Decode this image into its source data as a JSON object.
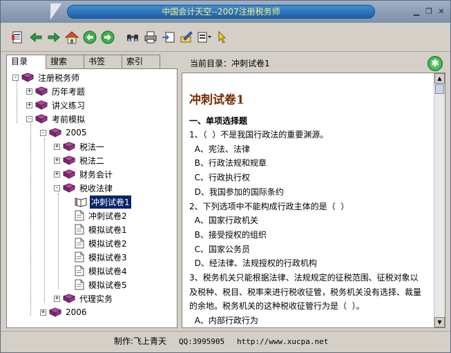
{
  "window": {
    "title": "中国会计天空--2007注册税务师"
  },
  "window_buttons": [
    "▁",
    "❐",
    "✕"
  ],
  "toolbar": {
    "buttons": [
      {
        "icon": "contents-icon"
      },
      {
        "icon": "arrow-left-icon"
      },
      {
        "icon": "arrow-right-icon"
      },
      {
        "icon": "home-icon"
      },
      {
        "icon": "back-circle-icon"
      },
      {
        "icon": "forward-circle-icon"
      },
      {
        "icon": "find-binoculars-icon"
      },
      {
        "icon": "print-icon"
      },
      {
        "icon": "bookmark-add-icon"
      },
      {
        "icon": "edit-notes-icon"
      },
      {
        "icon": "options-menu-icon"
      },
      {
        "icon": "pointer-hand-icon"
      }
    ]
  },
  "tabs": [
    "目录",
    "搜索",
    "书签",
    "索引"
  ],
  "tree": {
    "root": "注册税务师",
    "items": [
      {
        "label": "历年考题",
        "toggle": "+"
      },
      {
        "label": "讲义练习",
        "toggle": "+"
      },
      {
        "label": "考前模拟",
        "toggle": "-"
      },
      {
        "label": "2005",
        "toggle": "-"
      },
      {
        "label": "税法一",
        "toggle": "+"
      },
      {
        "label": "税法二",
        "toggle": "+"
      },
      {
        "label": "财务会计",
        "toggle": "+"
      },
      {
        "label": "税收法律",
        "toggle": "-"
      },
      {
        "label": "冲刺试卷1"
      },
      {
        "label": "冲刺试卷2"
      },
      {
        "label": "模拟试卷1"
      },
      {
        "label": "模拟试卷2"
      },
      {
        "label": "模拟试卷3"
      },
      {
        "label": "模拟试卷4"
      },
      {
        "label": "模拟试卷5"
      },
      {
        "label": "代理实务",
        "toggle": "+"
      },
      {
        "label": "2006",
        "toggle": "+"
      }
    ]
  },
  "content": {
    "breadcrumb_label": "当前目录：",
    "breadcrumb_value": "冲刺试卷1",
    "title": "冲刺试卷1",
    "section": "一、单项选择题",
    "lines": [
      "1、（  ）不是我国行政法的重要渊源。",
      "  A、宪法、法律",
      "  B、行政法规和规章",
      "  C、行政执行权",
      "  D、我国参加的国际条约",
      "2、下列选项中不能构成行政主体的是（  ）",
      "  A、国家行政机关",
      "  B、接受授权的组织",
      "  C、国家公务员",
      "  D、经法律、法规授权的行政机构",
      "3、税务机关只能根据法律、法规规定的征税范围、征税对象以",
      "及税种、税目、税率来进行税收征管，税务机关没有选择、裁量",
      "的余地。税务机关的这种税收征管行为是（  ）。",
      "  A、内部行政行为"
    ]
  },
  "status": {
    "maker": "制作:飞上青天",
    "qq": "QQ:3995905",
    "url": "http://www.xucpa.net"
  }
}
